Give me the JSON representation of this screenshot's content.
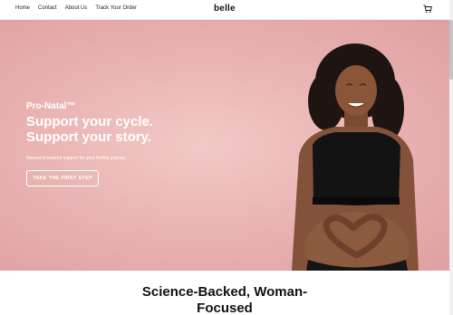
{
  "nav": {
    "links": [
      "Home",
      "Contact",
      "About Us",
      "Track Your Order"
    ],
    "logo": "belle",
    "cart_icon": "cart-icon"
  },
  "hero": {
    "eyebrow": "Pro-Natal™",
    "headline_1": "Support your cycle.",
    "headline_2": "Support your story.",
    "subtext": "Research-backed support for your fertility journey.",
    "cta": "TAKE THE FIRST STEP",
    "bg_color": "#e8b1b0"
  },
  "section": {
    "title_line_1": "Science-Backed, Woman-",
    "title_line_2": "Focused"
  }
}
